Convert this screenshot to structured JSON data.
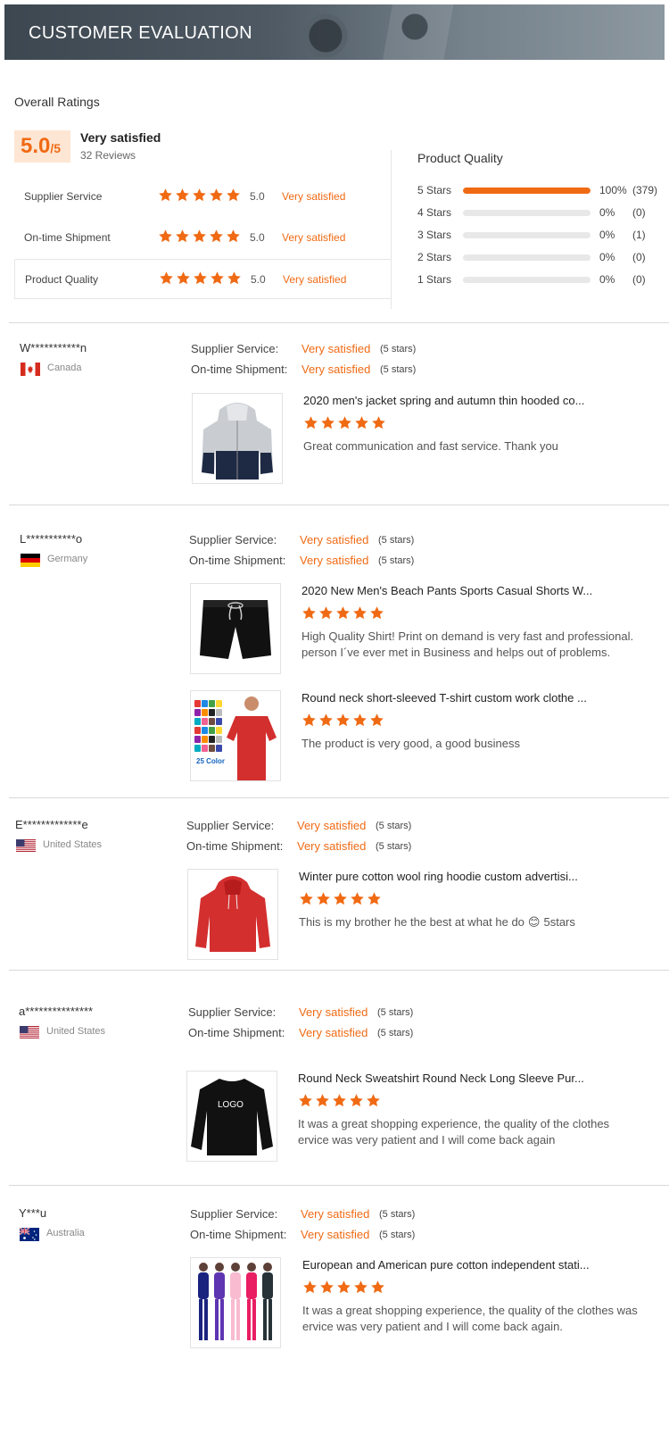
{
  "header": {
    "title": "CUSTOMER EVALUATION"
  },
  "overall": {
    "label": "Overall Ratings",
    "score": "5.0",
    "out_of": "/5",
    "verdict": "Very satisfied",
    "reviews": "32 Reviews",
    "rows": [
      {
        "label": "Supplier Service",
        "stars": 5,
        "value": "5.0",
        "verdict": "Very satisfied"
      },
      {
        "label": "On-time Shipment",
        "stars": 5,
        "value": "5.0",
        "verdict": "Very satisfied"
      },
      {
        "label": "Product Quality",
        "stars": 5,
        "value": "5.0",
        "verdict": "Very satisfied"
      }
    ]
  },
  "product_quality": {
    "title": "Product Quality",
    "rows": [
      {
        "label": "5 Stars",
        "fraction": 1.0,
        "percent": "100%",
        "count": "(379)"
      },
      {
        "label": "4 Stars",
        "fraction": 0,
        "percent": "0%",
        "count": "(0)"
      },
      {
        "label": "3 Stars",
        "fraction": 0,
        "percent": "0%",
        "count": "(1)"
      },
      {
        "label": "2 Stars",
        "fraction": 0,
        "percent": "0%",
        "count": "(0)"
      },
      {
        "label": "1 Stars",
        "fraction": 0,
        "percent": "0%",
        "count": "(0)"
      }
    ]
  },
  "labels": {
    "supplier_service": "Supplier Service:",
    "on_time_shipment": "On-time Shipment:",
    "very_satisfied": "Very satisfied",
    "five_stars": "(5 stars)"
  },
  "colors": {
    "accent": "#f06a14",
    "score_bg": "#fde6d3"
  },
  "reviews": [
    {
      "name": "W***********n",
      "country": "Canada",
      "flag": "canada-flag",
      "products": [
        {
          "title": "2020 men's jacket spring and autumn thin hooded co...",
          "stars": 5,
          "comment": "Great communication and fast service. Thank you",
          "thumb": "jacket-thumbnail"
        }
      ]
    },
    {
      "name": "L***********o",
      "country": "Germany",
      "flag": "germany-flag",
      "products": [
        {
          "title": "2020 New Men's Beach Pants Sports Casual Shorts W...",
          "stars": 5,
          "comment": "High Quality Shirt! Print on demand is very fast and professional.",
          "comment2": "person I´ve ever met in Business and helps out of problems.",
          "thumb": "shorts-thumbnail"
        },
        {
          "title": "Round neck short-sleeved T-shirt custom work clothe ...",
          "stars": 5,
          "comment": "The product is very good, a good business",
          "thumb": "tshirt-thumbnail",
          "thumb_label": "25 Color"
        }
      ]
    },
    {
      "name": "E*************e",
      "country": "United States",
      "flag": "us-flag",
      "products": [
        {
          "title": "Winter pure cotton wool ring hoodie custom advertisi...",
          "stars": 5,
          "comment": "This is my brother he the best at what he do",
          "emoji": "😊",
          "comment_tail": "5stars",
          "thumb": "hoodie-thumbnail"
        }
      ]
    },
    {
      "name": "a***************",
      "country": "United States",
      "flag": "us-flag",
      "products": [
        {
          "title": "Round Neck Sweatshirt Round Neck Long Sleeve Pur...",
          "stars": 5,
          "comment": "It was a great shopping experience, the quality of the clothes",
          "comment2": "ervice was very patient and I will come back again",
          "thumb": "sweatshirt-thumbnail",
          "thumb_label": "LOGO"
        }
      ]
    },
    {
      "name": "Y***u",
      "country": "Australia",
      "flag": "australia-flag",
      "products": [
        {
          "title": "European and American pure cotton independent stati...",
          "stars": 5,
          "comment": "It was a great shopping experience, the quality of the clothes was",
          "comment2": "ervice was very patient and I will come back again.",
          "thumb": "jumpsuits-thumbnail"
        }
      ]
    }
  ]
}
